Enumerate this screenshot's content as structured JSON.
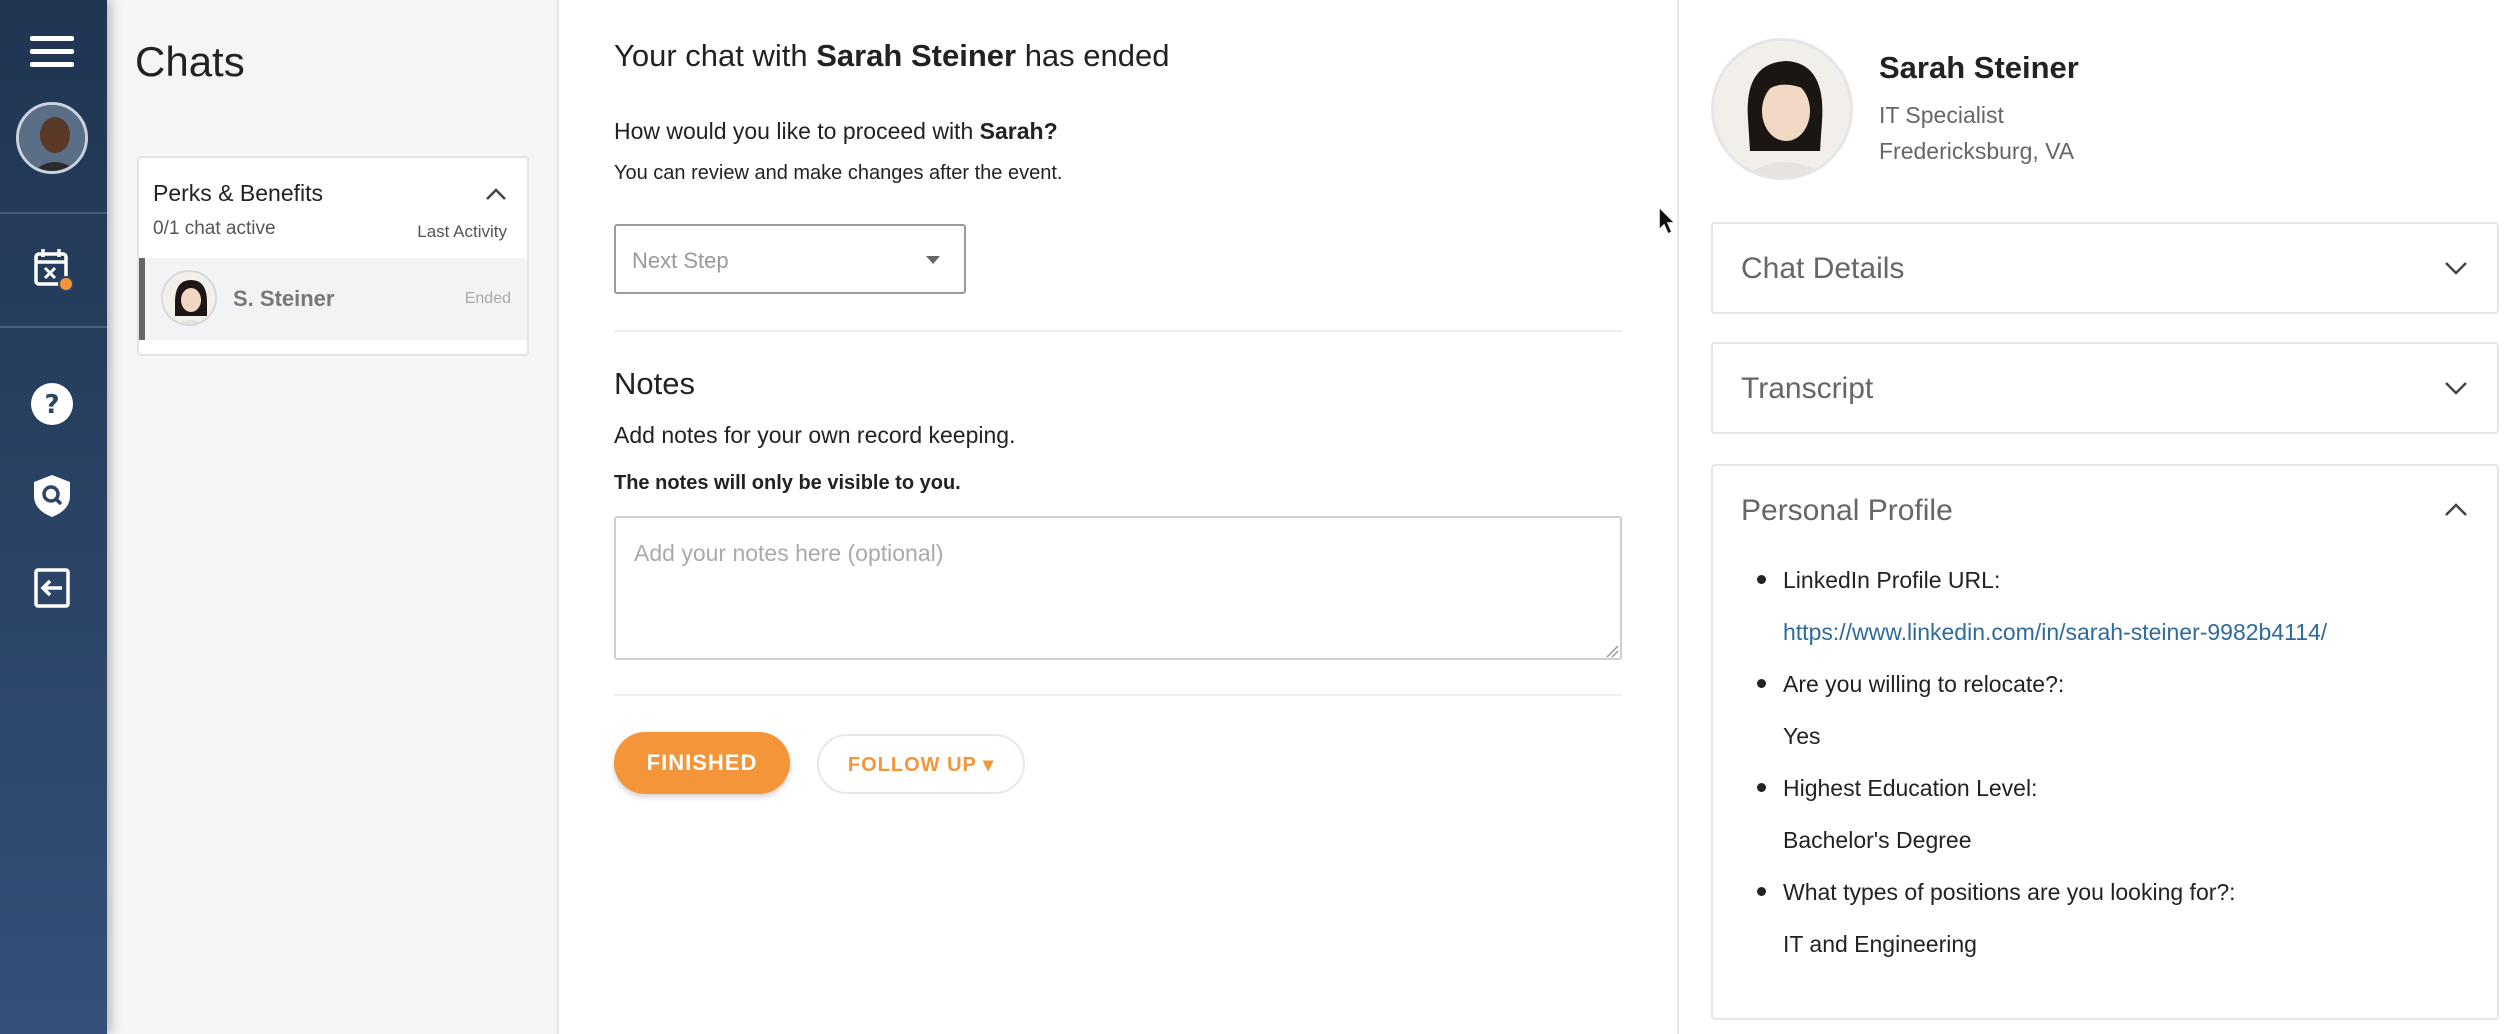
{
  "rail": {
    "icons": [
      "menu-icon",
      "calendar-x-icon",
      "help-icon",
      "shield-search-icon",
      "sign-out-icon"
    ],
    "notification_color": "#f39538"
  },
  "chats": {
    "title": "Chats",
    "group": {
      "name": "Perks & Benefits",
      "active": "0/1 chat active",
      "last_activity_label": "Last Activity"
    },
    "items": [
      {
        "name": "S. Steiner",
        "status": "Ended"
      }
    ]
  },
  "main": {
    "ended_prefix": "Your chat with ",
    "ended_name": "Sarah Steiner",
    "ended_suffix": " has ended",
    "proceed_prefix": "How would you like to proceed with ",
    "proceed_name": "Sarah?",
    "proceed_sub": "You can review and make changes after the event.",
    "next_step_placeholder": "Next Step",
    "notes_title": "Notes",
    "notes_desc": "Add notes for your own record keeping.",
    "notes_visibility": "The notes will only be visible to you.",
    "notes_placeholder": "Add your notes here (optional)",
    "finished_label": "FINISHED",
    "follow_up_label": "FOLLOW UP ▾",
    "accent_color": "#f39538"
  },
  "profile": {
    "name": "Sarah Steiner",
    "title": "IT Specialist",
    "location": "Fredericksburg, VA",
    "sections": {
      "chat_details": "Chat Details",
      "transcript": "Transcript",
      "personal_profile": "Personal Profile"
    },
    "fields": [
      {
        "label": "LinkedIn Profile URL:",
        "value": "https://www.linkedin.com/in/sarah-steiner-9982b4114/",
        "is_link": true
      },
      {
        "label": "Are you willing to relocate?:",
        "value": "Yes",
        "is_link": false
      },
      {
        "label": "Highest Education Level:",
        "value": "Bachelor's Degree",
        "is_link": false
      },
      {
        "label": "What types of positions are you looking for?:",
        "value": "IT and Engineering",
        "is_link": false
      }
    ],
    "link_color": "#2e6a9e"
  }
}
